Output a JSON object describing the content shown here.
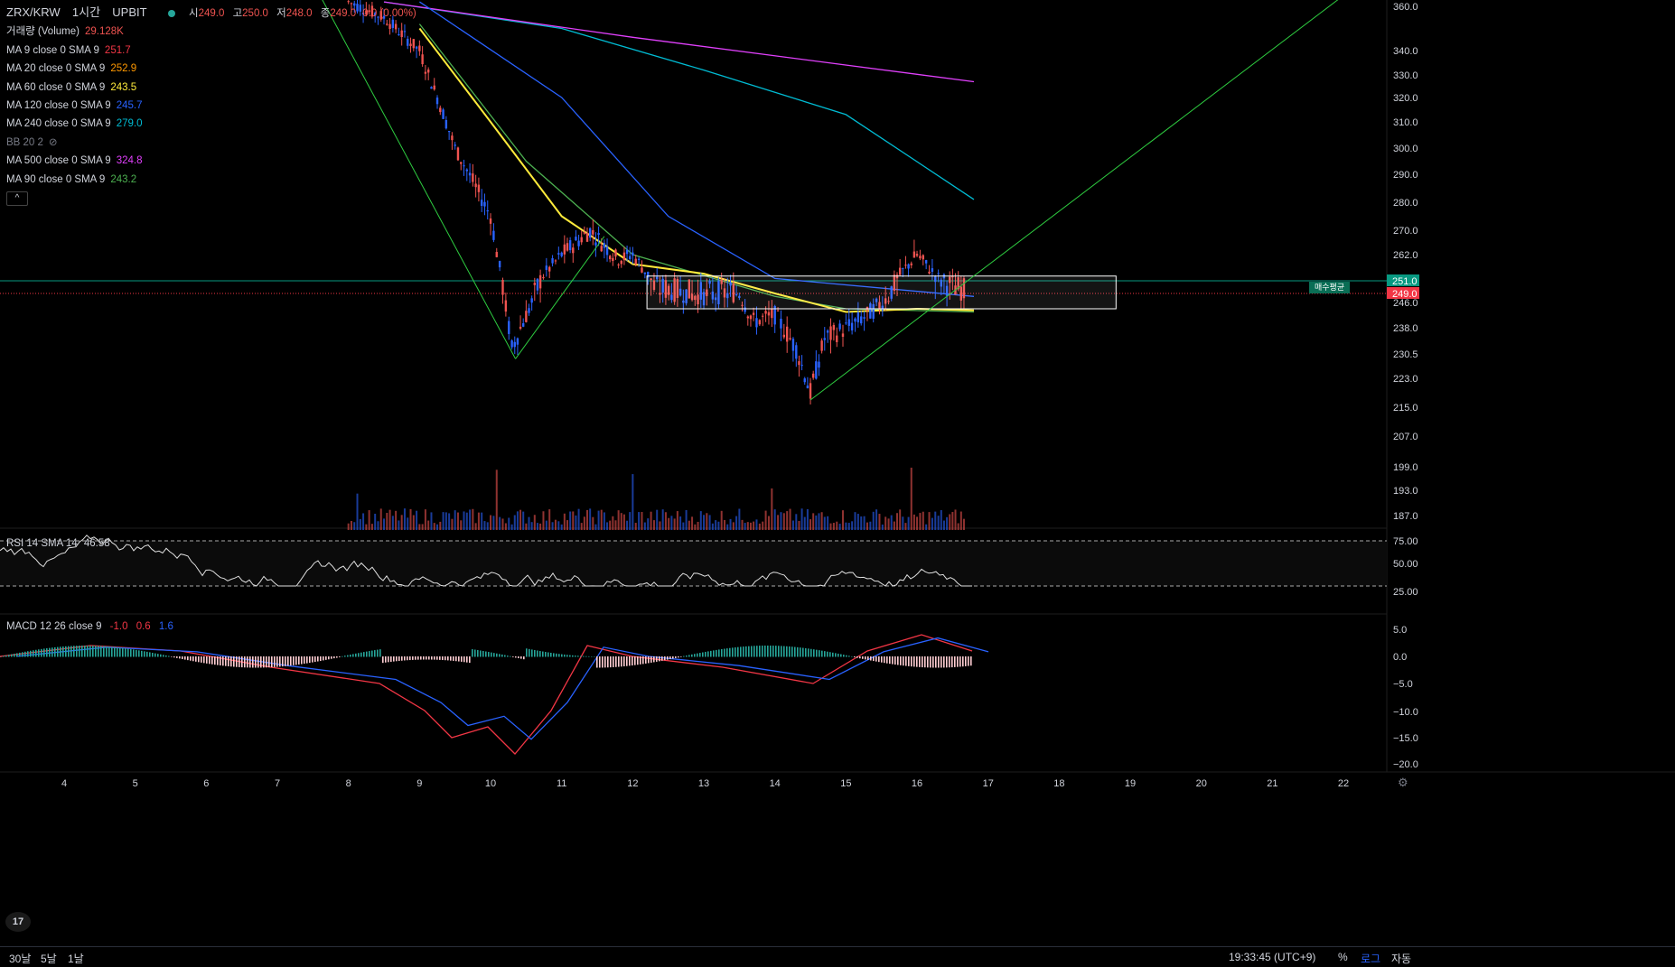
{
  "header": {
    "symbol": "ZRX/KRW",
    "interval": "1시간",
    "exchange": "UPBIT",
    "open_label": "시",
    "open": "249.0",
    "high_label": "고",
    "high": "250.0",
    "low_label": "저",
    "low": "248.0",
    "close_label": "종",
    "close": "249.0",
    "change": "0.0 (0.00%)"
  },
  "indicators": [
    {
      "label": "거래량 (Volume)",
      "value": "29.128K",
      "color": "#ef5350"
    },
    {
      "label": "MA 9 close 0 SMA 9",
      "value": "251.7",
      "color": "#f23645"
    },
    {
      "label": "MA 20 close 0 SMA 9",
      "value": "252.9",
      "color": "#ff9800"
    },
    {
      "label": "MA 60 close 0 SMA 9",
      "value": "243.5",
      "color": "#ffeb3b"
    },
    {
      "label": "MA 120 close 0 SMA 9",
      "value": "245.7",
      "color": "#2962ff"
    },
    {
      "label": "MA 240 close 0 SMA 9",
      "value": "279.0",
      "color": "#00bcd4"
    },
    {
      "label": "BB 20 2",
      "value": "",
      "color": "#787b86"
    },
    {
      "label": "MA 500 close 0 SMA 9",
      "value": "324.8",
      "color": "#e040fb"
    },
    {
      "label": "MA 90 close 0 SMA 9",
      "value": "243.2",
      "color": "#4caf50"
    }
  ],
  "rsi_legend": {
    "label": "RSI 14 SMA 14",
    "value": "46.58"
  },
  "macd_legend": {
    "label": "MACD 12 26 close 9",
    "macd": "-1.0",
    "signal": "0.6",
    "hist": "1.6"
  },
  "price_tags": {
    "ma": "251.0",
    "last": "249.0",
    "avg_buy": "매수평균"
  },
  "chart_data": {
    "type": "candlestick",
    "symbol": "ZRX/KRW",
    "interval": "1시간",
    "ylim": [
      180,
      362
    ],
    "price_ticks": [
      "360.0",
      "340.0",
      "330.0",
      "320.0",
      "310.0",
      "300.0",
      "290.0",
      "280.0",
      "270.0",
      "262.0",
      "251.0",
      "249.0",
      "246.0",
      "238.0",
      "230.5",
      "223.0",
      "215.0",
      "207.0",
      "199.0",
      "193.0",
      "187.0"
    ],
    "x_ticks": [
      "4",
      "5",
      "6",
      "7",
      "8",
      "9",
      "10",
      "11",
      "12",
      "13",
      "14",
      "15",
      "16",
      "17",
      "18",
      "19",
      "20",
      "21",
      "22"
    ],
    "close_path": [
      {
        "x": "8",
        "y": 362
      },
      {
        "x": "8.5",
        "y": 355
      },
      {
        "x": "9",
        "y": 340
      },
      {
        "x": "9.5",
        "y": 300
      },
      {
        "x": "10",
        "y": 275
      },
      {
        "x": "10.3",
        "y": 232
      },
      {
        "x": "10.7",
        "y": 252
      },
      {
        "x": "11",
        "y": 262
      },
      {
        "x": "11.4",
        "y": 270
      },
      {
        "x": "11.8",
        "y": 260
      },
      {
        "x": "12",
        "y": 262
      },
      {
        "x": "12.3",
        "y": 250
      },
      {
        "x": "13",
        "y": 248
      },
      {
        "x": "13.5",
        "y": 249
      },
      {
        "x": "13.7",
        "y": 240
      },
      {
        "x": "14",
        "y": 242
      },
      {
        "x": "14.3",
        "y": 232
      },
      {
        "x": "14.5",
        "y": 219
      },
      {
        "x": "14.7",
        "y": 235
      },
      {
        "x": "15",
        "y": 238
      },
      {
        "x": "15.3",
        "y": 242
      },
      {
        "x": "15.6",
        "y": 248
      },
      {
        "x": "16",
        "y": 262
      },
      {
        "x": "16.3",
        "y": 252
      },
      {
        "x": "16.7",
        "y": 249
      }
    ],
    "ma_lines": [
      {
        "name": "MA 240",
        "points": [
          [
            "8.5",
            362
          ],
          [
            "11",
            350
          ],
          [
            "13",
            332
          ],
          [
            "15",
            313
          ],
          [
            "16.8",
            281
          ]
        ]
      },
      {
        "name": "MA 500",
        "points": [
          [
            "8.5",
            362
          ],
          [
            "12",
            346
          ],
          [
            "16.8",
            327
          ]
        ]
      },
      {
        "name": "MA 120",
        "points": [
          [
            "9",
            362
          ],
          [
            "11",
            320
          ],
          [
            "12.5",
            275
          ],
          [
            "14",
            252
          ],
          [
            "16.8",
            248
          ]
        ]
      },
      {
        "name": "MA 90",
        "points": [
          [
            "9",
            352
          ],
          [
            "10.5",
            295
          ],
          [
            "12",
            262
          ],
          [
            "14",
            248
          ],
          [
            "15",
            244
          ],
          [
            "16.8",
            243
          ]
        ]
      },
      {
        "name": "MA 60",
        "points": [
          [
            "9",
            350
          ],
          [
            "10",
            310
          ],
          [
            "11",
            275
          ],
          [
            "12",
            258
          ],
          [
            "13",
            254
          ],
          [
            "14",
            249
          ],
          [
            "15",
            243
          ],
          [
            "16",
            244
          ],
          [
            "16.8",
            243.5
          ]
        ]
      }
    ],
    "support_box": {
      "x0": "12.2",
      "x1": "18.8",
      "y0": 244,
      "y1": 253
    },
    "volume": {
      "max_label": "29.128K"
    },
    "rsi": {
      "upper": 70,
      "lower": 30,
      "last": 46.58
    },
    "macd": {
      "macd": -1.0,
      "signal": 0.6,
      "hist": 1.6,
      "ticks": [
        "5.0",
        "0.0",
        "−5.0",
        "−10.0",
        "−15.0",
        "−20.0"
      ]
    },
    "rsi_ticks": [
      "75.00",
      "50.00",
      "25.00"
    ]
  },
  "bottom": {
    "ranges": [
      "30날",
      "5날",
      "1날"
    ],
    "time": "19:33:45 (UTC+9)",
    "percent": "%",
    "log": "로그",
    "auto": "자동"
  }
}
